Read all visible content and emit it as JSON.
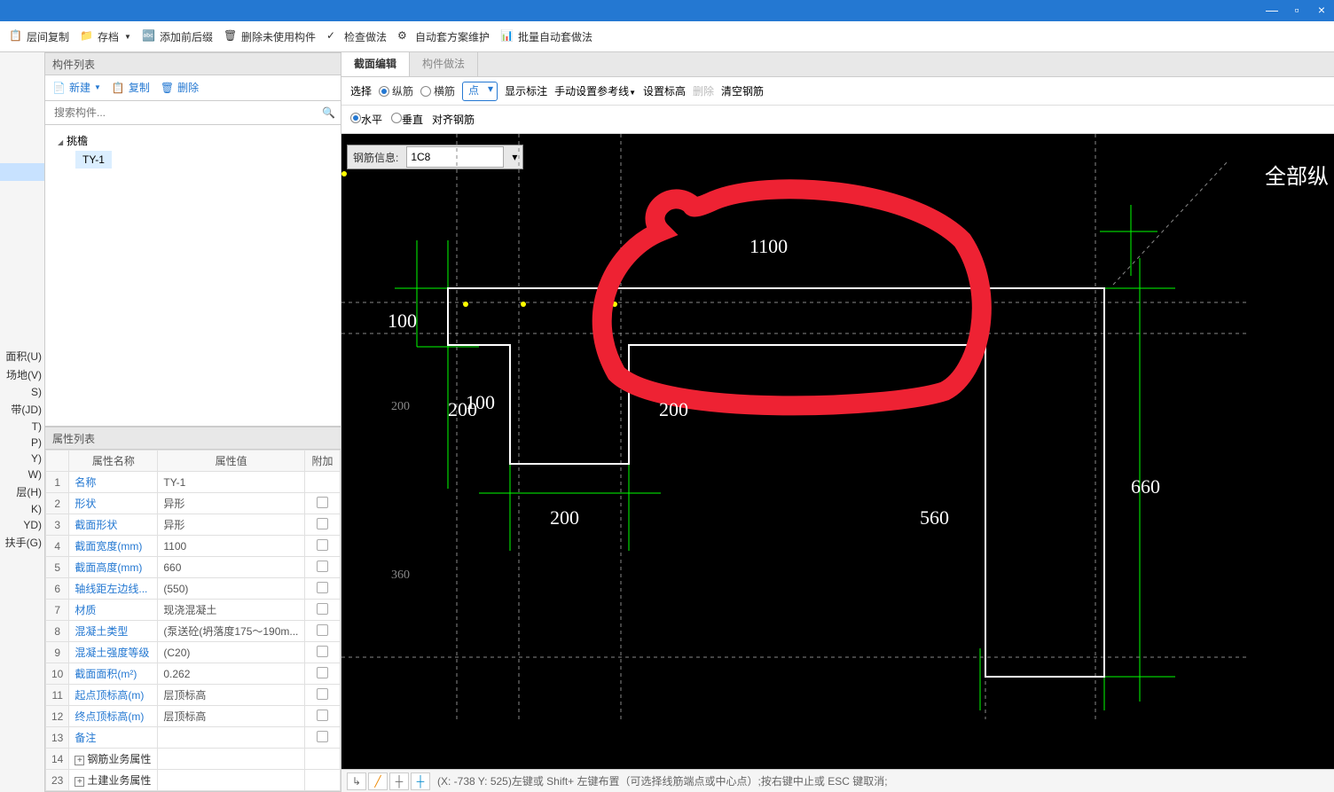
{
  "toolbar": {
    "items": [
      "层间复制",
      "存档",
      "添加前后缀",
      "删除未使用构件",
      "检查做法",
      "自动套方案维护",
      "批量自动套做法"
    ]
  },
  "leftLabels": [
    "面积(U)",
    "场地(V)",
    "S)",
    "",
    "带(JD)",
    "T)",
    "P)",
    "Y)",
    "W)",
    "层(H)",
    "K)",
    "YD)",
    "扶手(G)"
  ],
  "componentPanel": {
    "title": "构件列表",
    "tbNew": "新建",
    "tbCopy": "复制",
    "tbDelete": "删除",
    "searchPlaceholder": "搜索构件...",
    "treeParent": "挑檐",
    "treeChild": "TY-1"
  },
  "propPanel": {
    "title": "属性列表",
    "cols": [
      "",
      "属性名称",
      "属性值",
      "附加"
    ],
    "rows": [
      {
        "n": "1",
        "name": "名称",
        "val": "TY-1",
        "link": true,
        "chk": false
      },
      {
        "n": "2",
        "name": "形状",
        "val": "异形",
        "link": true,
        "gray": true,
        "chk": true
      },
      {
        "n": "3",
        "name": "截面形状",
        "val": "异形",
        "link": true,
        "chk": true
      },
      {
        "n": "4",
        "name": "截面宽度(mm)",
        "val": "1100",
        "link": true,
        "gray": true,
        "chk": true
      },
      {
        "n": "5",
        "name": "截面高度(mm)",
        "val": "660",
        "link": true,
        "gray": true,
        "chk": true
      },
      {
        "n": "6",
        "name": "轴线距左边线...",
        "val": "(550)",
        "black": true,
        "chk": true
      },
      {
        "n": "7",
        "name": "材质",
        "val": "现浇混凝土",
        "link": true,
        "chk": true
      },
      {
        "n": "8",
        "name": "混凝土类型",
        "val": "(泵送砼(坍落度175～190m...",
        "link": true,
        "chk": true
      },
      {
        "n": "9",
        "name": "混凝土强度等级",
        "val": "(C20)",
        "link": true,
        "chk": true
      },
      {
        "n": "10",
        "name": "截面面积(m²)",
        "val": "0.262",
        "link": true,
        "gray": true,
        "chk": true
      },
      {
        "n": "11",
        "name": "起点顶标高(m)",
        "val": "层顶标高",
        "black": true,
        "chk": true
      },
      {
        "n": "12",
        "name": "终点顶标高(m)",
        "val": "层顶标高",
        "black": true,
        "chk": true
      },
      {
        "n": "13",
        "name": "备注",
        "val": "",
        "black": true,
        "chk": true
      },
      {
        "n": "14",
        "name": "钢筋业务属性",
        "val": "",
        "expand": true
      },
      {
        "n": "23",
        "name": "土建业务属性",
        "val": "",
        "expand": true
      }
    ]
  },
  "tabs": {
    "t1": "截面编辑",
    "t2": "构件做法"
  },
  "subToolbar": {
    "select": "选择",
    "vert": "纵筋",
    "horz": "横筋",
    "point": "点",
    "showDim": "显示标注",
    "setRef": "手动设置参考线",
    "setLvl": "设置标高",
    "del": "删除",
    "clear": "清空钢筋"
  },
  "subToolbar2": {
    "h": "水平",
    "v": "垂直",
    "align": "对齐钢筋"
  },
  "rebarInfo": {
    "label": "钢筋信息:",
    "value": "1C8"
  },
  "cornerText": "全部纵",
  "diagram": {
    "d1100": "1100",
    "d100a": "100",
    "d100b": "100",
    "d200a": "200",
    "d200b": "200",
    "d200c": "200",
    "d200s": "200",
    "d360s": "360",
    "d560": "560",
    "d660": "660"
  },
  "status": {
    "coords": "(X: -738 Y: 525)左键或 Shift+ 左键布置（可选择线筋端点或中心点）;按右键中止或 ESC 键取消;"
  }
}
